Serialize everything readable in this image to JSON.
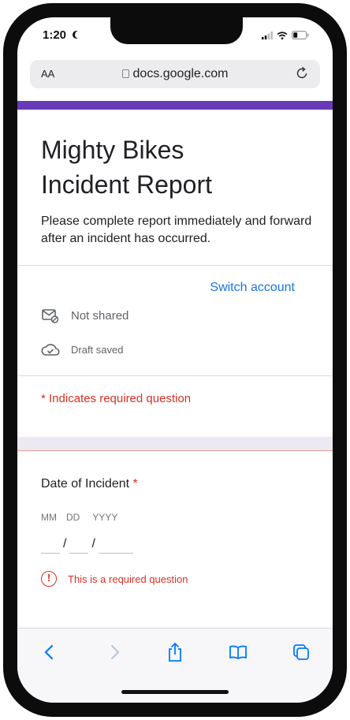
{
  "status_bar": {
    "time": "1:20"
  },
  "browser": {
    "text_size": "AA",
    "url": "docs.google.com"
  },
  "form": {
    "title_line1": "Mighty Bikes",
    "title_line2": "Incident Report",
    "description": "Please complete report immediately and forward after an incident has occurred.",
    "switch_account": "Switch account",
    "not_shared": "Not shared",
    "draft_saved": "Draft saved",
    "required_note": "* Indicates required question"
  },
  "question": {
    "title": "Date of Incident",
    "required_star": "*",
    "labels": {
      "month": "MM",
      "day": "DD",
      "year": "YYYY"
    },
    "separator": "/",
    "error_mark": "!",
    "error": "This is a required question"
  },
  "colors": {
    "accent": "#673ab7",
    "link": "#1a73e8",
    "error": "#d93025",
    "ios_blue": "#007aff"
  },
  "icons": {
    "toolbar": [
      "back-icon",
      "forward-icon",
      "share-icon",
      "bookmarks-icon",
      "tabs-icon"
    ],
    "status": [
      "moon-icon",
      "cellular-icon",
      "wifi-icon",
      "battery-icon"
    ]
  }
}
